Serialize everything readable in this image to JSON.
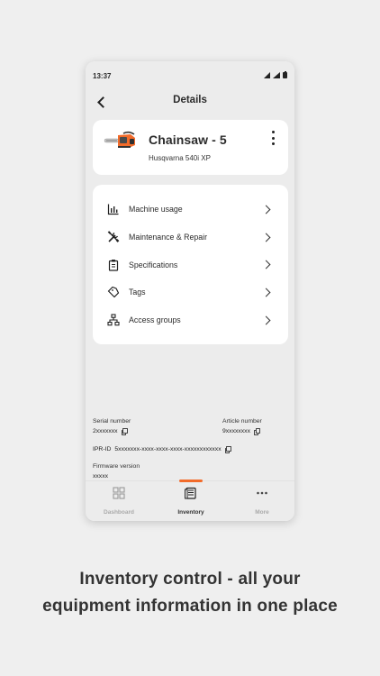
{
  "status_bar": {
    "time": "13:37"
  },
  "header": {
    "title": "Details"
  },
  "machine": {
    "name": "Chainsaw - 5",
    "model": "Husqvarna 540i XP"
  },
  "menu": {
    "items": [
      {
        "label": "Machine usage",
        "icon": "bar-chart-icon"
      },
      {
        "label": "Maintenance & Repair",
        "icon": "tools-icon"
      },
      {
        "label": "Specifications",
        "icon": "clipboard-icon"
      },
      {
        "label": "Tags",
        "icon": "tag-icon"
      },
      {
        "label": "Access groups",
        "icon": "hierarchy-icon"
      }
    ]
  },
  "info": {
    "serial": {
      "label": "Serial number",
      "value": "2xxxxxxx"
    },
    "article": {
      "label": "Article number",
      "value": "9xxxxxxxx"
    },
    "ipr": {
      "label": "IPR-ID",
      "value": "5xxxxxxx-xxxx-xxxx-xxxx-xxxxxxxxxxxx"
    },
    "firmware": {
      "label": "Firmware version",
      "value": "xxxxx"
    }
  },
  "bottom_nav": {
    "items": [
      {
        "label": "Dashboard",
        "icon": "grid-icon",
        "active": false
      },
      {
        "label": "Inventory",
        "icon": "inventory-icon",
        "active": true
      },
      {
        "label": "More",
        "icon": "more-dots-icon",
        "active": false
      }
    ]
  },
  "tagline": {
    "line1": "Inventory control - all your",
    "line2": "equipment information in one place"
  },
  "colors": {
    "accent": "#f26b2a",
    "background": "#efefef",
    "card": "#ffffff"
  }
}
